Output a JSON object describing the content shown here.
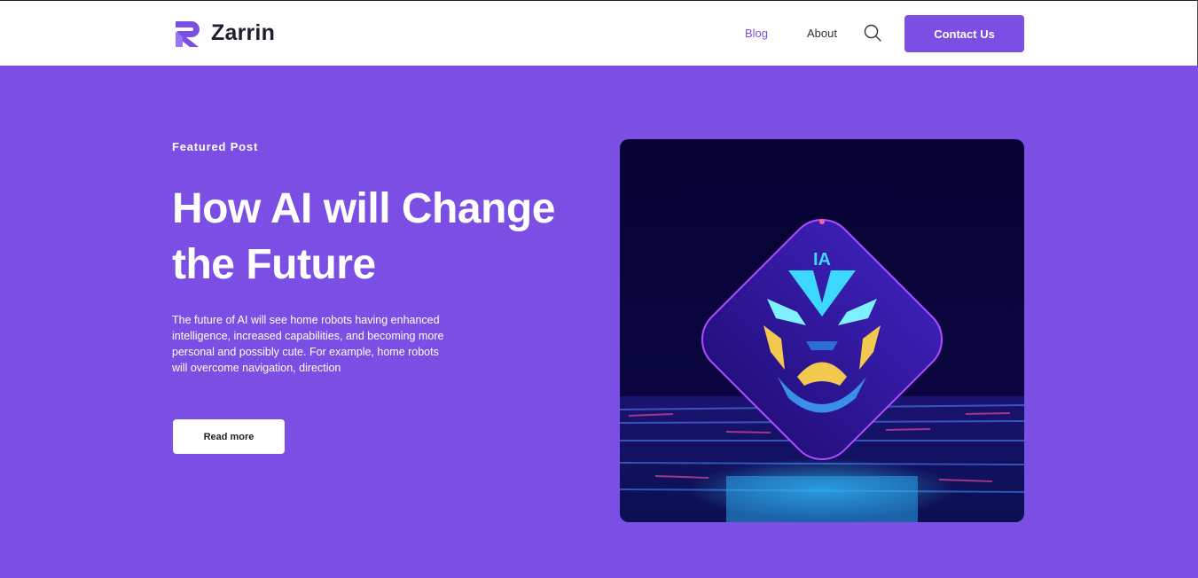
{
  "brand": {
    "name": "Zarrin",
    "accent": "#7b4fe3"
  },
  "nav": {
    "items": [
      {
        "label": "Blog",
        "active": true
      },
      {
        "label": "About",
        "active": false
      }
    ],
    "search_icon": "search-icon",
    "contact_label": "Contact Us"
  },
  "hero": {
    "kicker": "Featured Post",
    "title": "How AI will Change the Future",
    "excerpt": "The future of AI will see home robots having enhanced intelligence, increased capabilities, and becoming more personal and possibly cute. For example, home robots will overcome navigation, direction",
    "cta_label": "Read more",
    "image": {
      "badge_text": "IA"
    }
  },
  "colors": {
    "background": "#7b4fe3",
    "header": "#ffffff",
    "button_text_light": "#ffffff"
  }
}
